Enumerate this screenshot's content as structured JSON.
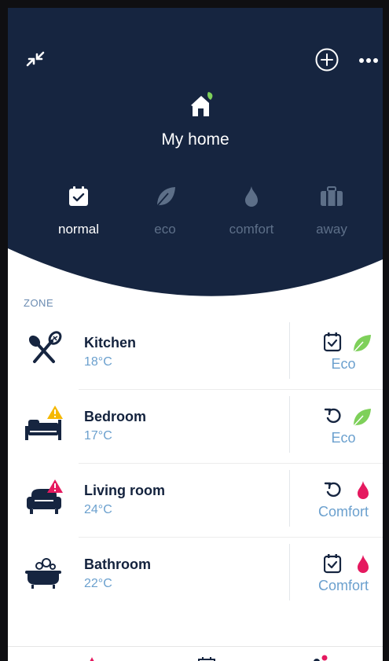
{
  "header": {
    "title": "My home",
    "icons": {
      "collapse": "collapse-arrows-icon",
      "add": "plus-circle-icon",
      "more": "more-dots-icon",
      "home": "home-icon"
    },
    "background_color": "#162540"
  },
  "modes": [
    {
      "label": "normal",
      "icon": "calendar-icon",
      "active": true
    },
    {
      "label": "eco",
      "icon": "leaf-icon",
      "active": false
    },
    {
      "label": "comfort",
      "icon": "flame-icon",
      "active": false
    },
    {
      "label": "away",
      "icon": "suitcase-icon",
      "active": false
    }
  ],
  "zones": {
    "heading": "ZONE",
    "items": [
      {
        "name": "Kitchen",
        "temp": "18°C",
        "icon": "kitchen-utensils-icon",
        "warning": false,
        "schedule_icon": "calendar-check-icon",
        "mode_icon": "leaf-icon",
        "mode": "Eco"
      },
      {
        "name": "Bedroom",
        "temp": "17°C",
        "icon": "bed-icon",
        "warning": true,
        "warning_color": "#f5b800",
        "schedule_icon": "manual-override-icon",
        "mode_icon": "leaf-icon",
        "mode": "Eco"
      },
      {
        "name": "Living room",
        "temp": "24°C",
        "icon": "armchair-icon",
        "warning": true,
        "warning_color": "#e5195f",
        "schedule_icon": "manual-override-icon",
        "mode_icon": "flame-icon",
        "mode": "Comfort"
      },
      {
        "name": "Bathroom",
        "temp": "22°C",
        "icon": "bathtub-icon",
        "warning": false,
        "schedule_icon": "calendar-check-icon",
        "mode_icon": "flame-icon",
        "mode": "Comfort"
      }
    ]
  },
  "colors": {
    "navy": "#162540",
    "accent_blue": "#6ba0ce",
    "eco_green": "#7ed05a",
    "comfort_pink": "#e5195f",
    "inactive_mode": "#5d6f88"
  }
}
